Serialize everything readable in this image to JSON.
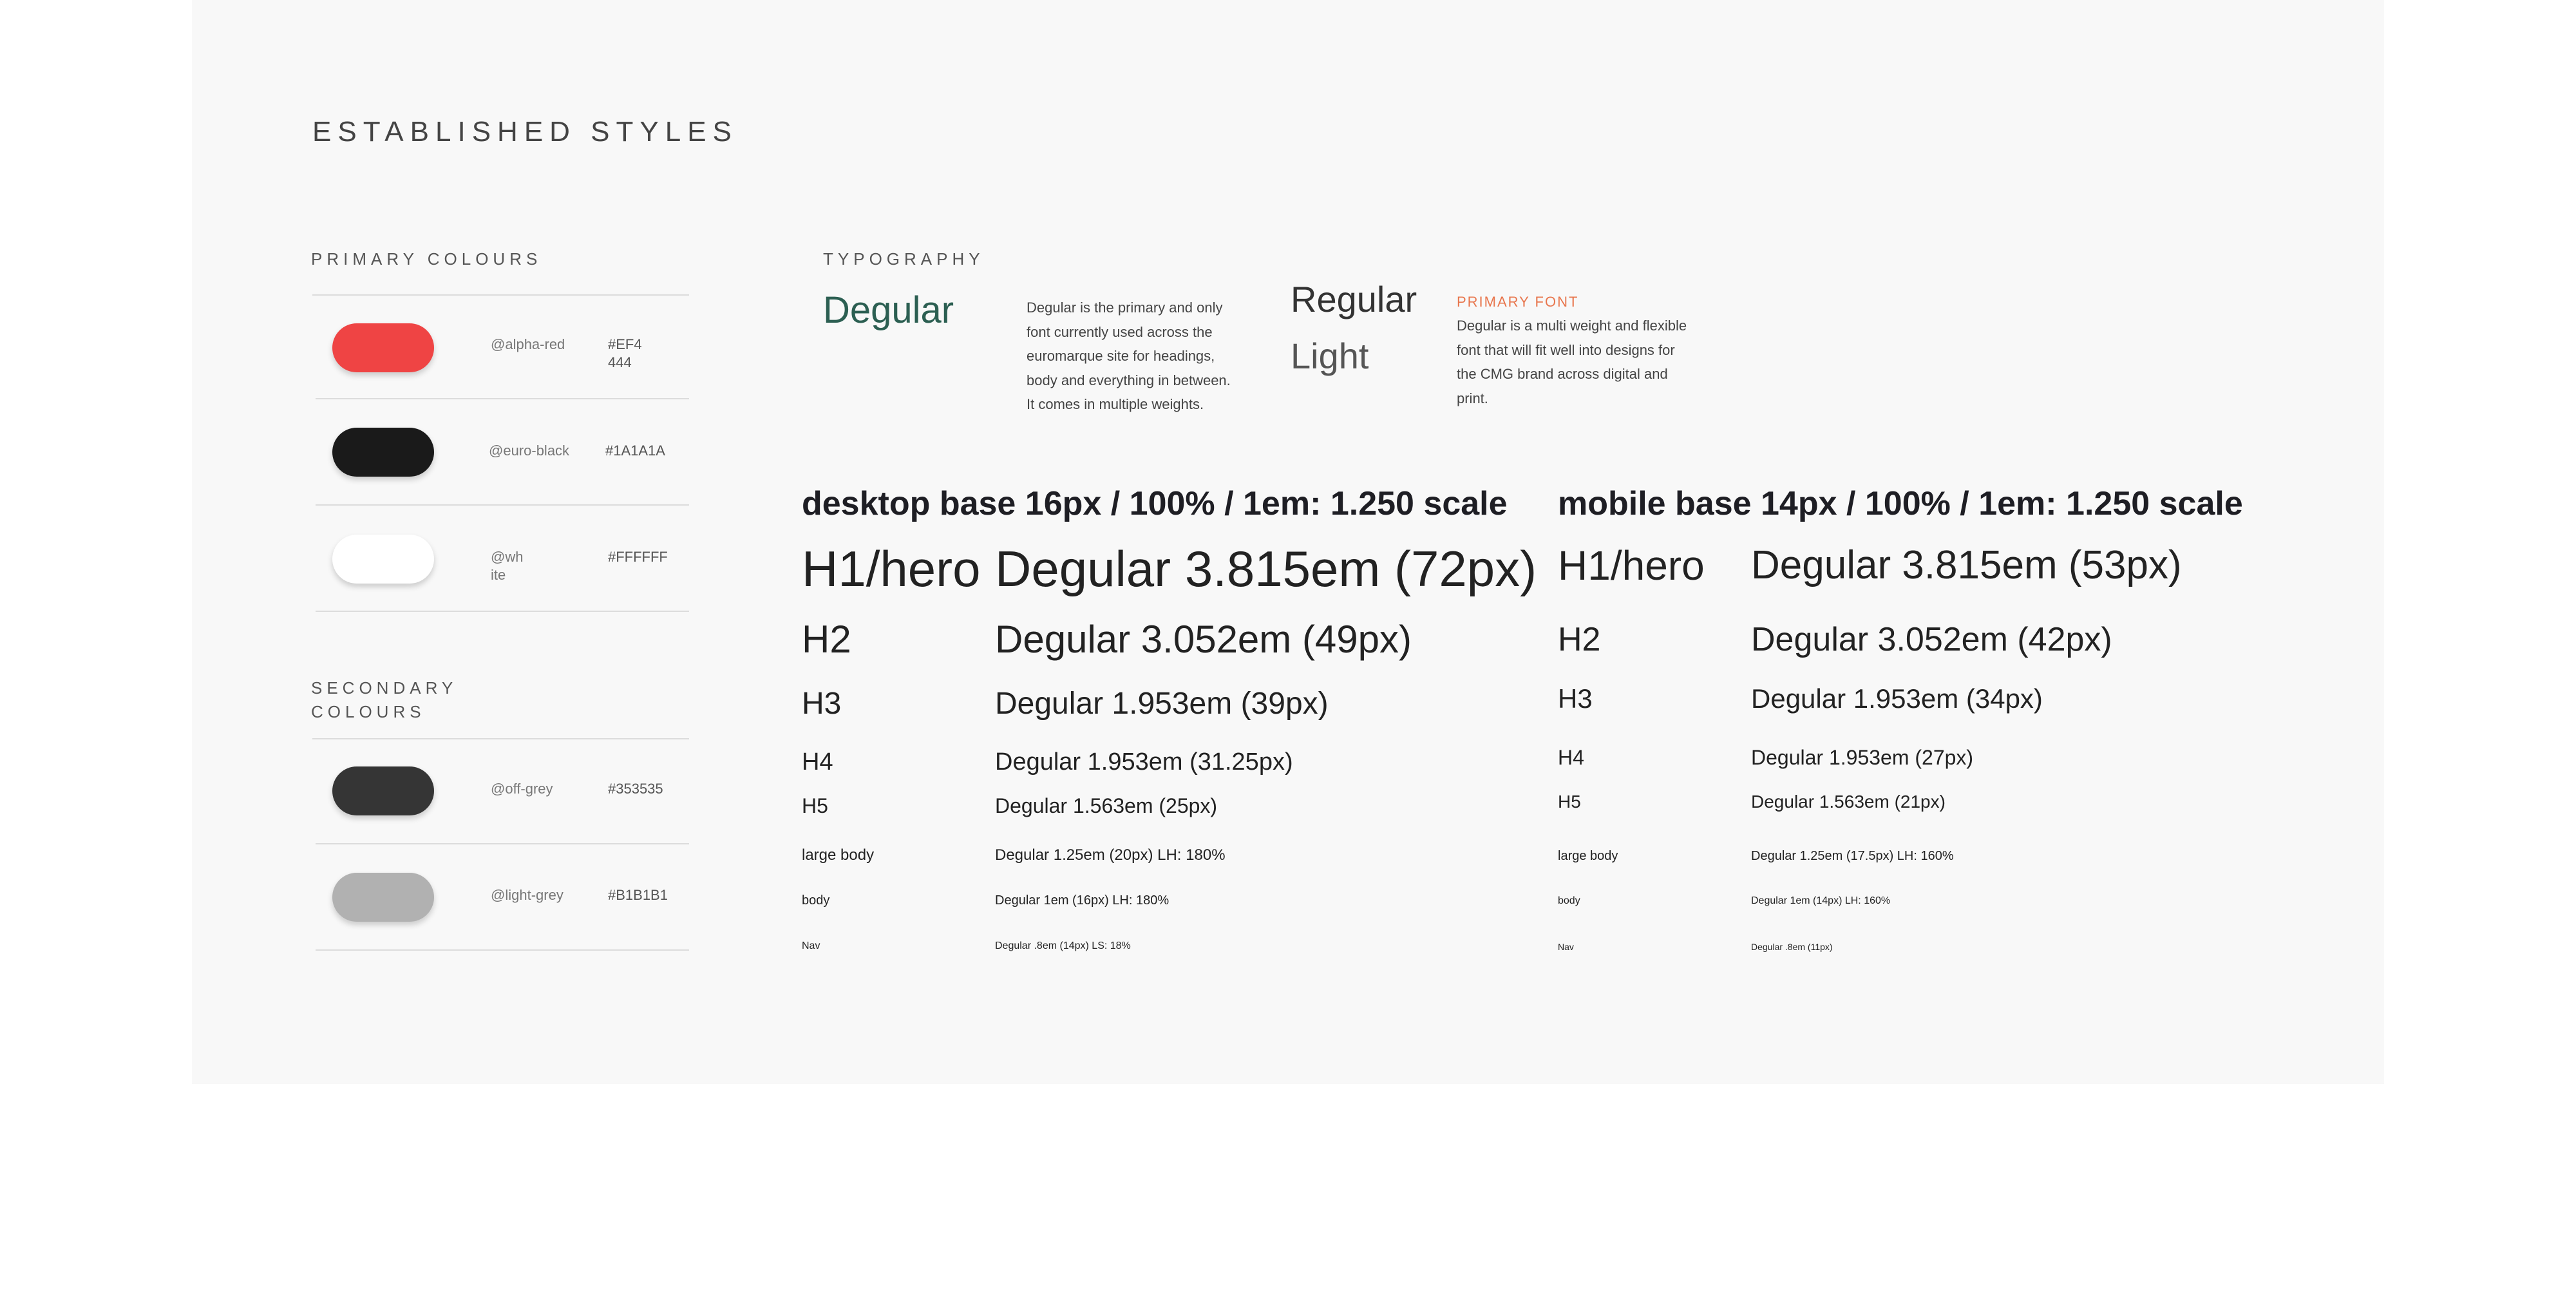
{
  "page": {
    "title": "ESTABLISHED STYLES"
  },
  "colours": {
    "primary_label": "PRIMARY COLOURS",
    "secondary_label_line1": "SECONDARY",
    "secondary_label_line2": "COLOURS",
    "primary": [
      {
        "var_line1": "@alpha-red",
        "var_line2": "",
        "hex_line1": "#EF4",
        "hex_line2": "444",
        "color": "#EF4444"
      },
      {
        "var_line1": "@euro-black",
        "var_line2": "",
        "hex_line1": "#1A1A1A",
        "hex_line2": "",
        "color": "#1A1A1A"
      },
      {
        "var_line1": "@wh",
        "var_line2": "ite",
        "hex_line1": "#FFFFFF",
        "hex_line2": "",
        "color": "#FFFFFF"
      }
    ],
    "secondary": [
      {
        "var_line1": "@off-grey",
        "var_line2": "",
        "hex_line1": "#353535",
        "hex_line2": "",
        "color": "#353535"
      },
      {
        "var_line1": "@light-grey",
        "var_line2": "",
        "hex_line1": "#B1B1B1",
        "hex_line2": "",
        "color": "#B1B1B1"
      }
    ]
  },
  "typography": {
    "label": "TYPOGRAPHY",
    "font_name": "Degular",
    "description": "Degular is the primary and only font currently used across the euromarque site for headings, body and everything in between. It comes in multiple weights.",
    "weight_regular": "Regular",
    "weight_light": "Light",
    "primary_font_label": "PRIMARY FONT",
    "primary_font_desc": "Degular is a multi weight and flexible font that will fit well into designs for the CMG brand across digital and print."
  },
  "desktop_scale": {
    "heading": "desktop base 16px / 100% / 1em: 1.250 scale",
    "rows": [
      {
        "name": "H1/hero",
        "value": "Degular 3.815em (72px)"
      },
      {
        "name": "H2",
        "value": "Degular 3.052em (49px)"
      },
      {
        "name": "H3",
        "value": "Degular 1.953em (39px)"
      },
      {
        "name": "H4",
        "value": "Degular 1.953em (31.25px)"
      },
      {
        "name": "H5",
        "value": "Degular 1.563em (25px)"
      },
      {
        "name": "large body",
        "value": "Degular 1.25em (20px) LH: 180%"
      },
      {
        "name": "body",
        "value": "Degular 1em (16px) LH: 180%"
      },
      {
        "name": "Nav",
        "value": "Degular .8em (14px) LS: 18%"
      }
    ]
  },
  "mobile_scale": {
    "heading": "mobile base 14px / 100% / 1em: 1.250 scale",
    "rows": [
      {
        "name": "H1/hero",
        "value": "Degular 3.815em (53px)"
      },
      {
        "name": "H2",
        "value": "Degular 3.052em (42px)"
      },
      {
        "name": "H3",
        "value": "Degular 1.953em (34px)"
      },
      {
        "name": "H4",
        "value": "Degular 1.953em (27px)"
      },
      {
        "name": "H5",
        "value": "Degular 1.563em (21px)"
      },
      {
        "name": "large body",
        "value": "Degular 1.25em (17.5px) LH: 160%"
      },
      {
        "name": "body",
        "value": "Degular 1em (14px) LH: 160%"
      },
      {
        "name": "Nav",
        "value": "Degular .8em (11px)"
      }
    ]
  }
}
